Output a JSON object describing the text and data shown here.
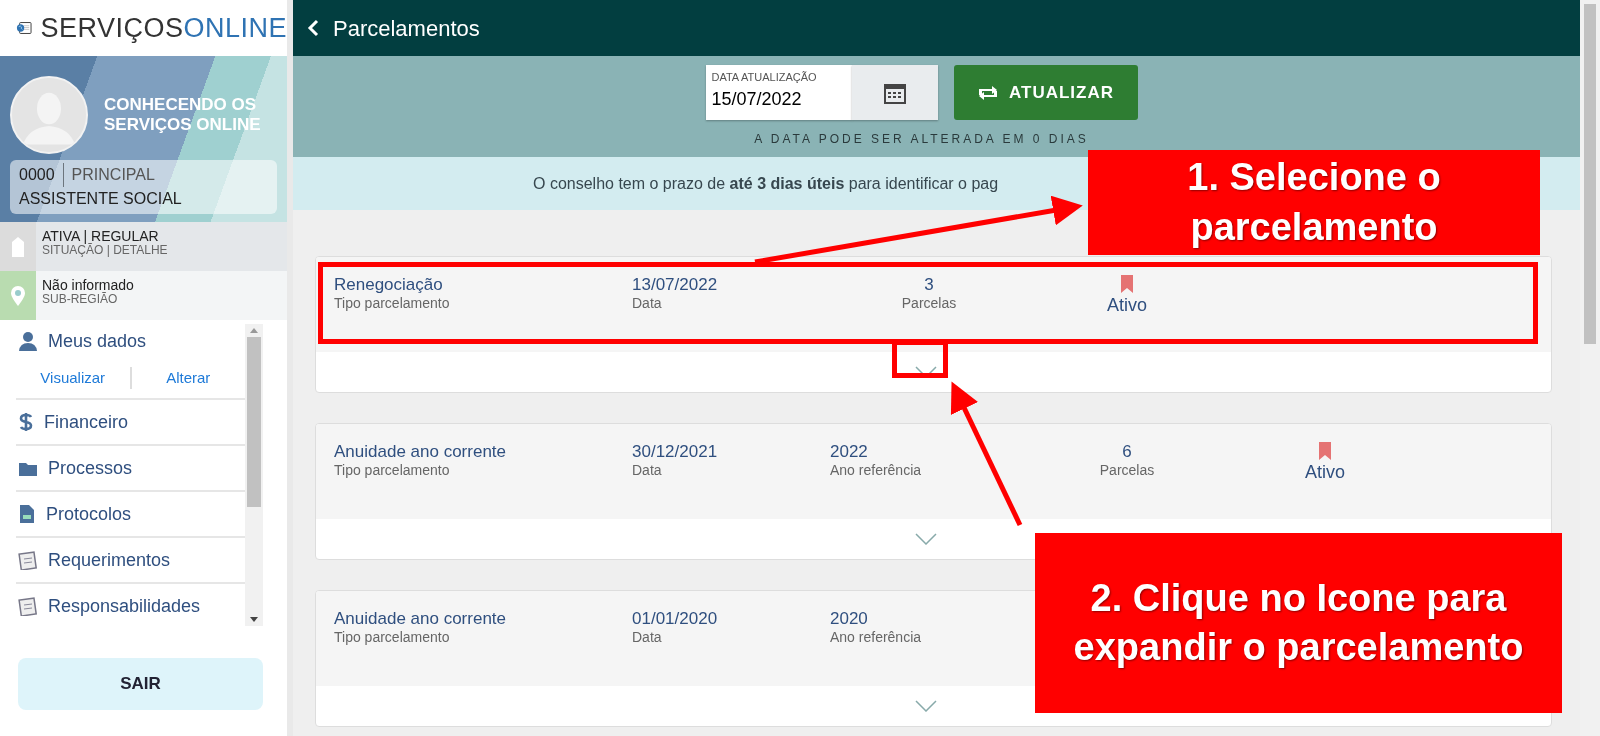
{
  "sidebar": {
    "logo": {
      "text_dark": "SERVIÇOS",
      "text_accent": "ONLINE"
    },
    "profile": {
      "name": "CONHECENDO OS SERVIÇOS ONLINE",
      "code": "0000",
      "role_type": "PRINCIPAL",
      "role": "ASSISTENTE SOCIAL"
    },
    "status_rows": [
      {
        "kind": "tag",
        "title": "ATIVA | REGULAR",
        "subtitle": "SITUAÇÃO | DETALHE"
      },
      {
        "kind": "pin",
        "title": "Não informado",
        "subtitle": "SUB-REGIÃO"
      }
    ],
    "menu": [
      {
        "label": "Meus dados",
        "expanded": true,
        "links": [
          "Visualizar",
          "Alterar"
        ]
      },
      {
        "label": "Financeiro",
        "expanded": false
      },
      {
        "label": "Processos",
        "expanded": false
      },
      {
        "label": "Protocolos",
        "expanded": false
      },
      {
        "label": "Requerimentos",
        "expanded": false
      },
      {
        "label": "Responsabilidades",
        "expanded": false
      }
    ],
    "logout": "SAIR"
  },
  "header": {
    "title": "Parcelamentos"
  },
  "toolbar": {
    "date_label": "DATA ATUALIZAÇÃO",
    "date_value": "15/07/2022",
    "refresh_button": "ATUALIZAR",
    "hint": "A DATA PODE SER ALTERADA EM 0 DIAS"
  },
  "notice": "O conselho tem o prazo de **até 3 dias úteis** para identificar o pag",
  "installments": [
    {
      "expanded": false,
      "status": "Ativo",
      "fields": [
        {
          "kind": "text",
          "value": "Renegociação",
          "label": "Tipo parcelamento"
        },
        {
          "kind": "text",
          "value": "13/07/2022",
          "label": "Data"
        },
        {
          "kind": "count",
          "value": "3",
          "label": "Parcelas"
        }
      ]
    },
    {
      "expanded": false,
      "status": "Ativo",
      "fields": [
        {
          "kind": "text",
          "value": "Anuidade ano corrente",
          "label": "Tipo parcelamento"
        },
        {
          "kind": "text",
          "value": "30/12/2021",
          "label": "Data"
        },
        {
          "kind": "text",
          "value": "2022",
          "label": "Ano referência"
        },
        {
          "kind": "count",
          "value": "6",
          "label": "Parcelas"
        }
      ]
    },
    {
      "expanded": false,
      "fields": [
        {
          "kind": "text",
          "value": "Anuidade ano corrente",
          "label": "Tipo parcelamento"
        },
        {
          "kind": "text",
          "value": "01/01/2020",
          "label": "Data"
        },
        {
          "kind": "text",
          "value": "2020",
          "label": "Ano referência"
        }
      ]
    }
  ],
  "callouts": [
    "1. Selecione o parcelamento",
    "2. Clique no Icone para expandir o parcelamento"
  ]
}
